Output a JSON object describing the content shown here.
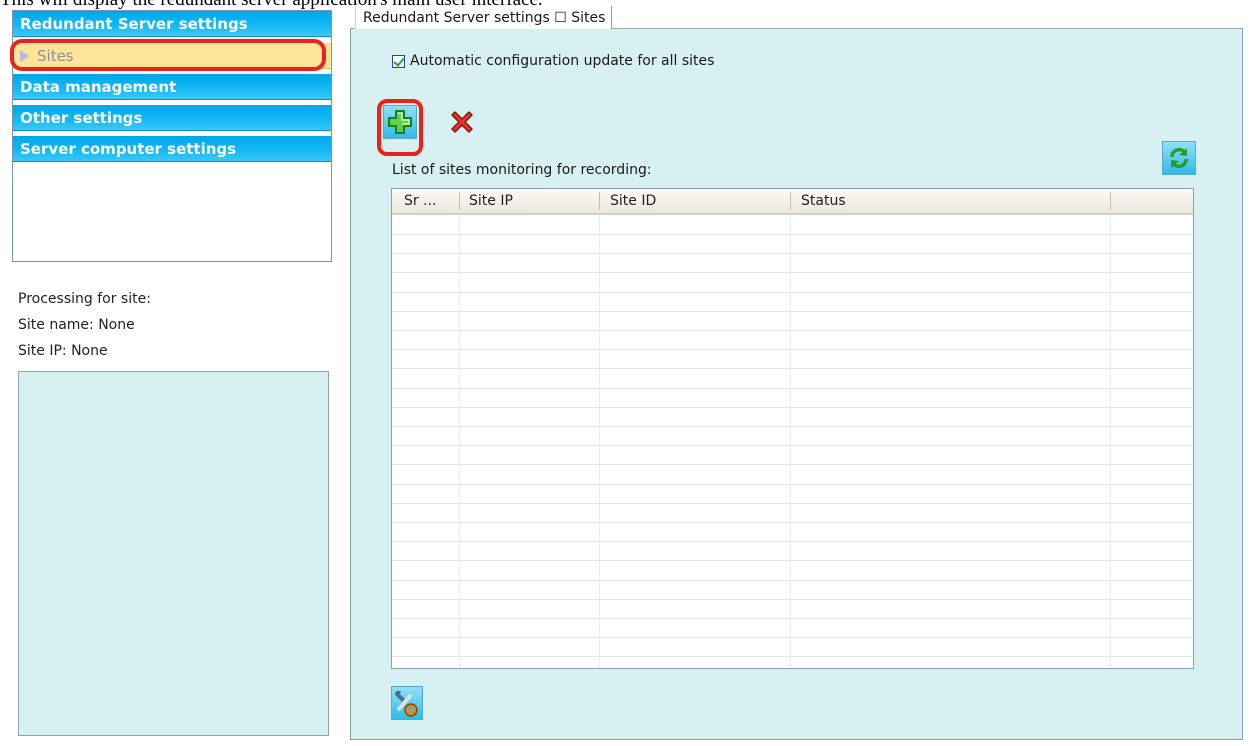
{
  "caption": "This will display the redundant server application's main user interface.",
  "sidebar": {
    "items": [
      {
        "label": "Redundant Server settings"
      },
      {
        "label": "Sites"
      },
      {
        "label": "Data management"
      },
      {
        "label": "Other settings"
      },
      {
        "label": "Server computer settings"
      }
    ]
  },
  "processing": {
    "heading": "Processing for site:",
    "site_name": "Site name: None",
    "site_ip": "Site IP: None"
  },
  "tab": {
    "label": "Redundant Server settings ☐ Sites"
  },
  "settings": {
    "auto_update_label": "Automatic configuration update for all sites",
    "auto_update_checked": true
  },
  "toolbar": {
    "add_icon": "plus-icon",
    "delete_icon": "delete-x-icon",
    "refresh_icon": "refresh-icon",
    "settings_icon": "tools-icon"
  },
  "sites_list": {
    "label": "List of sites monitoring for recording:",
    "columns": [
      "Sr ...",
      "Site IP",
      "Site ID",
      "Status"
    ],
    "rows": []
  },
  "colors": {
    "nav_blue": "#12b8f4",
    "nav_selected": "#fde598",
    "panel_bg": "#d7f0f1",
    "highlight_red": "#e8231c"
  }
}
